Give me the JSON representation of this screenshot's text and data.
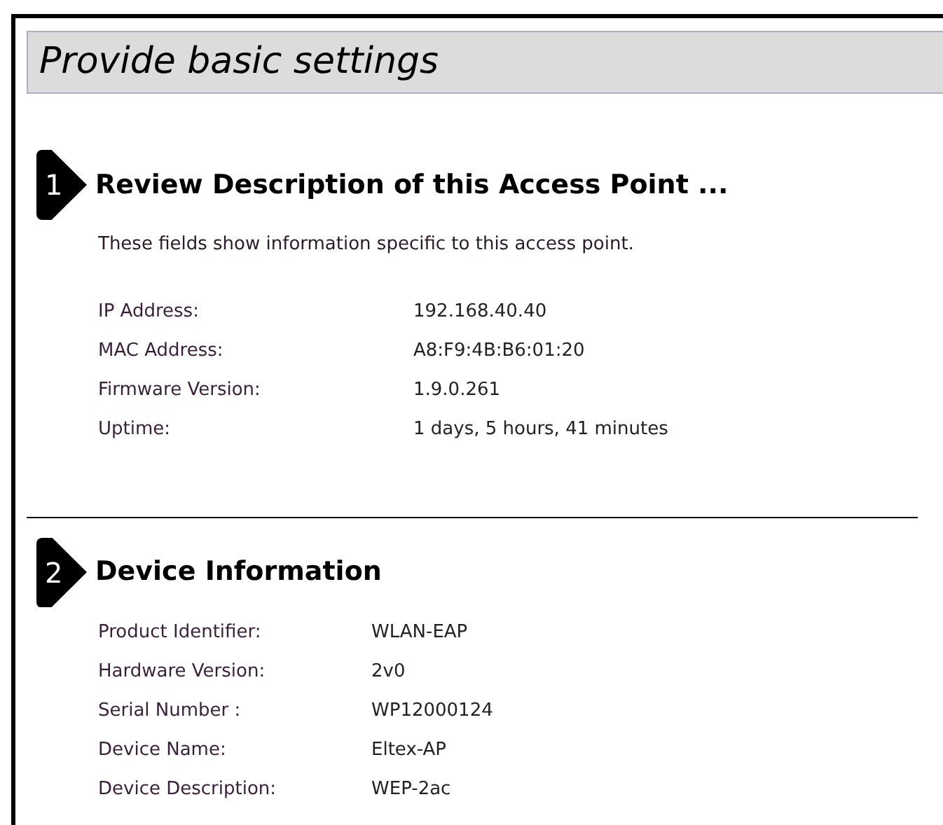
{
  "page_title": "Provide basic settings",
  "sections": [
    {
      "step": "1",
      "heading": "Review Description of this Access Point ...",
      "description": "These fields show information specific to this access point.",
      "fields": [
        {
          "label": "IP Address:",
          "value": "192.168.40.40"
        },
        {
          "label": "MAC Address:",
          "value": "A8:F9:4B:B6:01:20"
        },
        {
          "label": "Firmware Version:",
          "value": "1.9.0.261"
        },
        {
          "label": "Uptime:",
          "value": "1 days, 5 hours, 41 minutes"
        }
      ]
    },
    {
      "step": "2",
      "heading": "Device Information",
      "fields": [
        {
          "label": "Product Identifier:",
          "value": "WLAN-EAP"
        },
        {
          "label": "Hardware Version:",
          "value": "2v0"
        },
        {
          "label": "Serial Number :",
          "value": "WP12000124"
        },
        {
          "label": "Device Name:",
          "value": "Eltex-AP"
        },
        {
          "label": "Device Description:",
          "value": "WEP-2ac"
        }
      ]
    }
  ]
}
